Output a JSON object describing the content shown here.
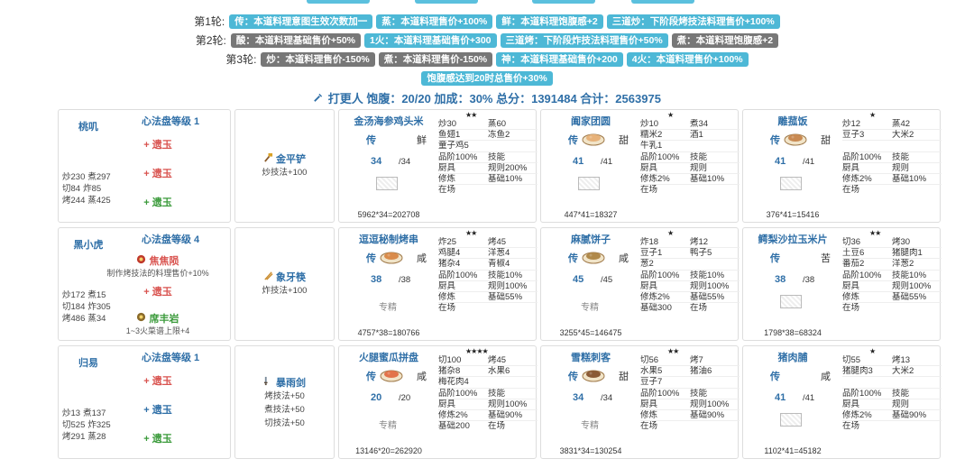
{
  "rounds": [
    {
      "label": "第1轮:",
      "tags": [
        {
          "text": "传：本道料理意图生效次数加一",
          "style": "blue"
        },
        {
          "text": "蒸：本道料理售价+100%",
          "style": "blue"
        },
        {
          "text": "鲜：本道料理饱腹感+2",
          "style": "blue"
        },
        {
          "text": "三道炒：下阶段烤技法料理售价+100%",
          "style": "blue"
        }
      ]
    },
    {
      "label": "第2轮:",
      "tags": [
        {
          "text": "酸：本道料理基础售价+50%",
          "style": "gray"
        },
        {
          "text": "1火：本道料理基础售价+300",
          "style": "blue"
        },
        {
          "text": "三道烤：下阶段炸技法料理售价+50%",
          "style": "blue"
        },
        {
          "text": "煮：本道料理饱腹感+2",
          "style": "gray"
        }
      ]
    },
    {
      "label": "第3轮:",
      "tags": [
        {
          "text": "炒：本道料理售价-150%",
          "style": "gray"
        },
        {
          "text": "煮：本道料理售价-150%",
          "style": "gray"
        },
        {
          "text": "神：本道料理基础售价+200",
          "style": "blue"
        },
        {
          "text": "4火：本道料理售价+100%",
          "style": "blue"
        }
      ]
    },
    {
      "label": "",
      "tags": [
        {
          "text": "饱腹感达到20时总售价+30%",
          "style": "blue"
        }
      ]
    }
  ],
  "summary": {
    "icon": "hammer-icon",
    "text": "打更人 饱腹：20/20 加成：30% 总分：1391484 合计：2563975"
  },
  "chefs": [
    {
      "name": "桃叽",
      "level": "心法盘等级 1",
      "gems": [
        {
          "text": "+ 遗玉",
          "color": "red"
        },
        {
          "text": "+ 遗玉",
          "color": "red"
        },
        {
          "text": "+ 遗玉",
          "color": "green"
        }
      ],
      "stats": [
        [
          "炒230",
          "煮297"
        ],
        [
          "切84",
          "炸85"
        ],
        [
          "烤244",
          "蒸425"
        ]
      ]
    },
    {
      "name": "黑小虎",
      "level": "心法盘等级 4",
      "gems": [
        {
          "text": "焦焦陨",
          "color": "red",
          "note": "制作烤技法的料理售价+10%"
        },
        {
          "text": "+ 遗玉",
          "color": "red"
        },
        {
          "text": "席丰岩",
          "color": "green",
          "note": "1~3火菜谱上限+4"
        }
      ],
      "stats": [
        [
          "炒172",
          "煮15"
        ],
        [
          "切184",
          "炸305"
        ],
        [
          "烤486",
          "蒸34"
        ]
      ]
    },
    {
      "name": "归易",
      "level": "心法盘等级 1",
      "gems": [
        {
          "text": "+ 遗玉",
          "color": "red"
        },
        {
          "text": "+ 遗玉",
          "color": "blue"
        },
        {
          "text": "+ 遗玉",
          "color": "green"
        }
      ],
      "stats": [
        [
          "炒13",
          "煮137"
        ],
        [
          "切525",
          "炸325"
        ],
        [
          "烤291",
          "蒸28"
        ]
      ]
    }
  ],
  "equips": [
    {
      "name": "金平铲",
      "icon": "spatula-icon",
      "skills": [
        "炒技法+100"
      ]
    },
    {
      "name": "象牙筷",
      "icon": "chopsticks-icon",
      "skills": [
        "炸技法+100"
      ]
    },
    {
      "name": "暴雨剑",
      "icon": "sword-icon",
      "skills": [
        "烤技法+50",
        "煮技法+50",
        "切技法+50"
      ]
    }
  ],
  "dishes": [
    [
      {
        "name": "金汤海参鸡头米",
        "stars": "★★",
        "rarity": "传",
        "taste": "鲜",
        "qty": "34",
        "qmax": "/34",
        "has_pic": false,
        "special": "",
        "formula": "5962*34=202708",
        "grid": [
          [
            "炒30",
            "蒸60"
          ],
          [
            "鱼翅1",
            "冻鱼2"
          ],
          [
            "童子鸡5",
            ""
          ],
          [
            "品阶100%",
            "技能"
          ],
          [
            "厨具",
            "规则200%"
          ],
          [
            "修炼",
            "基础10%"
          ],
          [
            "在场",
            ""
          ]
        ]
      },
      {
        "name": "阖家团圆",
        "stars": "★",
        "rarity": "传",
        "taste": "甜",
        "qty": "41",
        "qmax": "/41",
        "has_pic": true,
        "pic_color": "#e7b27a",
        "special": "",
        "formula": "447*41=18327",
        "grid": [
          [
            "炒10",
            "煮34"
          ],
          [
            "糯米2",
            "酒1"
          ],
          [
            "牛乳1",
            ""
          ],
          [
            "品阶100%",
            "技能"
          ],
          [
            "厨具",
            "规则"
          ],
          [
            "修炼2%",
            "基础10%"
          ],
          [
            "在场",
            ""
          ]
        ]
      },
      {
        "name": "雕菰饭",
        "stars": "★",
        "rarity": "传",
        "taste": "甜",
        "qty": "41",
        "qmax": "/41",
        "has_pic": true,
        "pic_color": "#c98a52",
        "special": "",
        "formula": "376*41=15416",
        "grid": [
          [
            "炒12",
            "蒸42"
          ],
          [
            "豆子3",
            "大米2"
          ],
          [
            "",
            ""
          ],
          [
            "品阶100%",
            "技能"
          ],
          [
            "厨具",
            "规则"
          ],
          [
            "修炼2%",
            "基础10%"
          ],
          [
            "在场",
            ""
          ]
        ]
      }
    ],
    [
      {
        "name": "逗逗秘制烤串",
        "stars": "★★",
        "rarity": "传",
        "taste": "咸",
        "qty": "38",
        "qmax": "/38",
        "has_pic": true,
        "pic_color": "#d98b4a",
        "special": "专精",
        "formula": "4757*38=180766",
        "grid": [
          [
            "炸25",
            "烤45"
          ],
          [
            "鸡腿4",
            "洋葱4"
          ],
          [
            "猪杂4",
            "青椒4"
          ],
          [
            "品阶100%",
            "技能10%"
          ],
          [
            "厨具",
            "规则100%"
          ],
          [
            "修炼",
            "基础55%"
          ],
          [
            "在场",
            ""
          ]
        ]
      },
      {
        "name": "麻腻饼子",
        "stars": "★",
        "rarity": "传",
        "taste": "咸",
        "qty": "45",
        "qmax": "/45",
        "has_pic": true,
        "pic_color": "#b0894a",
        "special": "专精",
        "formula": "3255*45=146475",
        "grid": [
          [
            "炸18",
            "烤12"
          ],
          [
            "豆子1",
            "鸭子5"
          ],
          [
            "葱2",
            ""
          ],
          [
            "品阶100%",
            "技能10%"
          ],
          [
            "厨具",
            "规则100%"
          ],
          [
            "修炼2%",
            "基础55%"
          ],
          [
            "基础300",
            "在场"
          ]
        ]
      },
      {
        "name": "鳄梨沙拉玉米片",
        "stars": "★★",
        "rarity": "传",
        "taste": "苦",
        "qty": "38",
        "qmax": "/38",
        "has_pic": false,
        "special": "",
        "formula": "1798*38=68324",
        "grid": [
          [
            "切36",
            "烤30"
          ],
          [
            "土豆6",
            "猪腿肉1"
          ],
          [
            "番茄2",
            "洋葱2"
          ],
          [
            "品阶100%",
            "技能10%"
          ],
          [
            "厨具",
            "规则100%"
          ],
          [
            "修炼",
            "基础55%"
          ],
          [
            "在场",
            ""
          ]
        ]
      }
    ],
    [
      {
        "name": "火腿蜜瓜拼盘",
        "stars": "★★★★",
        "rarity": "传",
        "taste": "咸",
        "qty": "20",
        "qmax": "/20",
        "has_pic": true,
        "pic_color": "#e2734a",
        "special": "专精",
        "formula": "13146*20=262920",
        "grid": [
          [
            "切100",
            "烤45"
          ],
          [
            "猪杂8",
            "水果6"
          ],
          [
            "梅花肉4",
            ""
          ],
          [
            "品阶100%",
            "技能"
          ],
          [
            "厨具",
            "规则100%"
          ],
          [
            "修炼2%",
            "基础90%"
          ],
          [
            "基础200",
            "在场"
          ]
        ]
      },
      {
        "name": "雪糕刺客",
        "stars": "★★",
        "rarity": "传",
        "taste": "甜",
        "qty": "34",
        "qmax": "/34",
        "has_pic": true,
        "pic_color": "#8a5a36",
        "special": "专精",
        "formula": "3831*34=130254",
        "grid": [
          [
            "切56",
            "烤7"
          ],
          [
            "水果5",
            "猪油6"
          ],
          [
            "豆子7",
            ""
          ],
          [
            "品阶100%",
            "技能"
          ],
          [
            "厨具",
            "规则100%"
          ],
          [
            "修炼",
            "基础90%"
          ],
          [
            "在场",
            ""
          ]
        ]
      },
      {
        "name": "猪肉脯",
        "stars": "★",
        "rarity": "传",
        "taste": "咸",
        "qty": "41",
        "qmax": "/41",
        "has_pic": false,
        "special": "",
        "formula": "1102*41=45182",
        "grid": [
          [
            "切55",
            "烤13"
          ],
          [
            "猪腿肉3",
            "大米2"
          ],
          [
            "",
            ""
          ],
          [
            "品阶100%",
            "技能"
          ],
          [
            "厨具",
            "规则"
          ],
          [
            "修炼2%",
            "基础90%"
          ],
          [
            "在场",
            ""
          ]
        ]
      }
    ]
  ]
}
